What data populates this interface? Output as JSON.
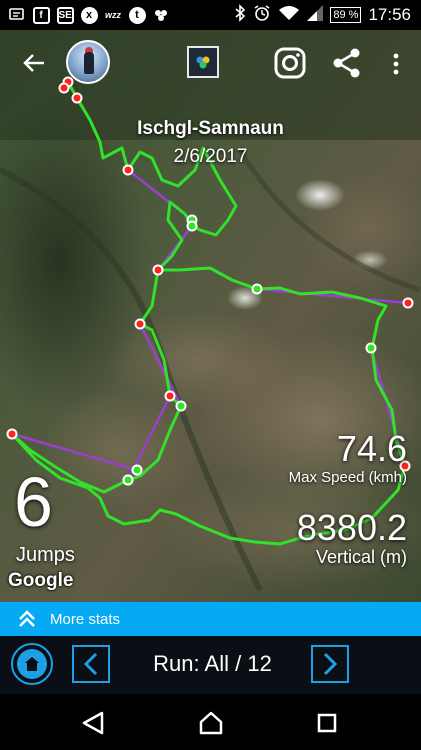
{
  "status_bar": {
    "left_icons": [
      "notification-icon",
      "facebook-icon",
      "stackexchange-icon",
      "xda-icon",
      "wzz-icon",
      "tumblr-icon",
      "messenger-icon"
    ],
    "battery": "89 %",
    "time": "17:56"
  },
  "map": {
    "title": "Ischgl-Samnaun",
    "date": "2/6/2017",
    "attribution": "Google",
    "track_color": "#31e12a",
    "lift_color": "#9b3fd0"
  },
  "stats": {
    "jumps_value": "6",
    "jumps_label": "Jumps",
    "max_speed_value": "74.6",
    "max_speed_label": "Max Speed (kmh)",
    "vertical_value": "8380.2",
    "vertical_label": "Vertical (m)"
  },
  "more_stats": {
    "label": "More stats",
    "color": "#06a9f4"
  },
  "run_nav": {
    "label": "Run: All / 12",
    "accent": "#1ea0e6"
  }
}
